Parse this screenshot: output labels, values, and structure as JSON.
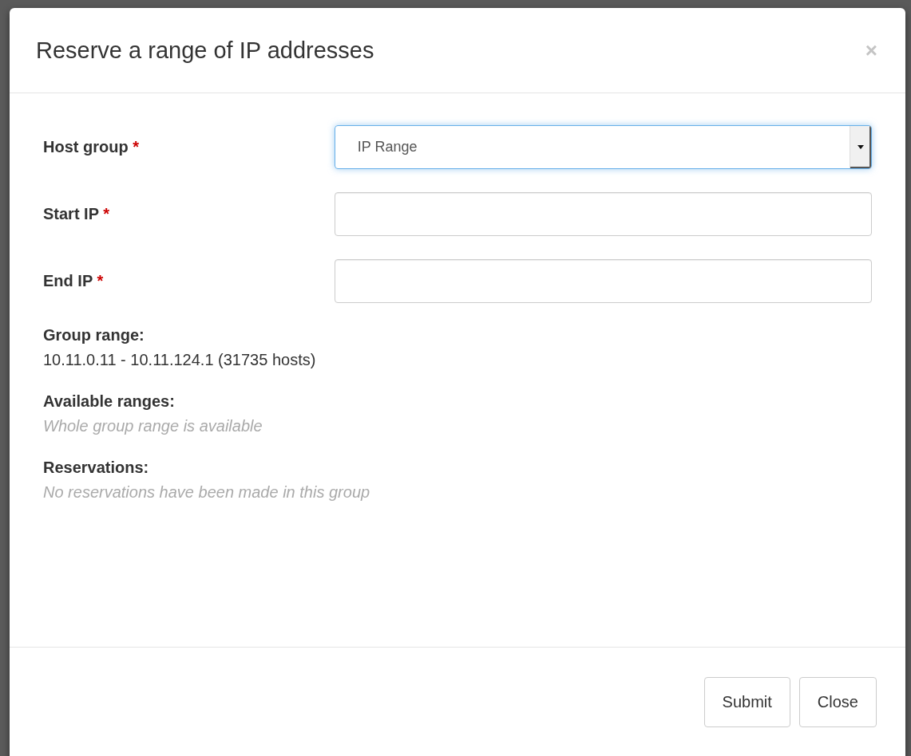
{
  "dialog": {
    "title": "Reserve a range of IP addresses",
    "close_symbol": "×"
  },
  "fields": [
    {
      "kind": "select",
      "label": "Host group",
      "required_mark": "*",
      "value": "IP Range",
      "focused": true
    },
    {
      "kind": "text",
      "label": "Start IP",
      "required_mark": "*",
      "focused": false
    },
    {
      "kind": "text",
      "label": "End IP",
      "required_mark": "*",
      "focused": false
    }
  ],
  "sections": [
    {
      "heading": "Group range:",
      "text": "10.11.0.11 - 10.11.124.1 (31735 hosts)",
      "muted": false
    },
    {
      "heading": "Available ranges:",
      "text": "Whole group range is available",
      "muted": true
    },
    {
      "heading": "Reservations:",
      "text": "No reservations have been made in this group",
      "muted": true
    }
  ],
  "buttons": [
    "Submit",
    "Close"
  ]
}
